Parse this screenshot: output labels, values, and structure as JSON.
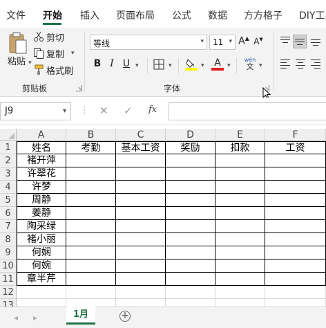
{
  "ribbon_tabs": [
    "文件",
    "开始",
    "插入",
    "页面布局",
    "公式",
    "数据",
    "方方格子",
    "DIY工具"
  ],
  "active_tab": "开始",
  "clipboard": {
    "paste_label": "粘贴",
    "cut_label": "剪切",
    "copy_label": "复制",
    "format_painter_label": "格式刷",
    "group_label": "剪贴板"
  },
  "font": {
    "font_name": "等线",
    "font_size": "11",
    "grow_label": "A",
    "shrink_label": "A",
    "bold_label": "B",
    "italic_label": "I",
    "underline_label": "U",
    "phonetic_label": "wén",
    "group_label": "字体",
    "highlight_color": "#ffff00",
    "font_color": "#e02020"
  },
  "formula_bar": {
    "name_box": "J9",
    "cancel_icon": "✕",
    "enter_icon": "✓",
    "fx_label": "fx",
    "formula": ""
  },
  "columns": [
    "A",
    "B",
    "C",
    "D",
    "E",
    "F"
  ],
  "rows": [
    "1",
    "2",
    "3",
    "4",
    "5",
    "6",
    "7",
    "8",
    "9",
    "10",
    "11",
    "12",
    "13"
  ],
  "header_row": [
    "姓名",
    "考勤",
    "基本工资",
    "奖励",
    "扣款",
    "工资"
  ],
  "names": [
    "褚开萍",
    "许翠花",
    "许梦",
    "周静",
    "姜静",
    "陶采绿",
    "褚小丽",
    "何娴",
    "何婉",
    "章半芹"
  ],
  "sheet_tabs": [
    "1月"
  ],
  "accent_color": "#1e7145"
}
